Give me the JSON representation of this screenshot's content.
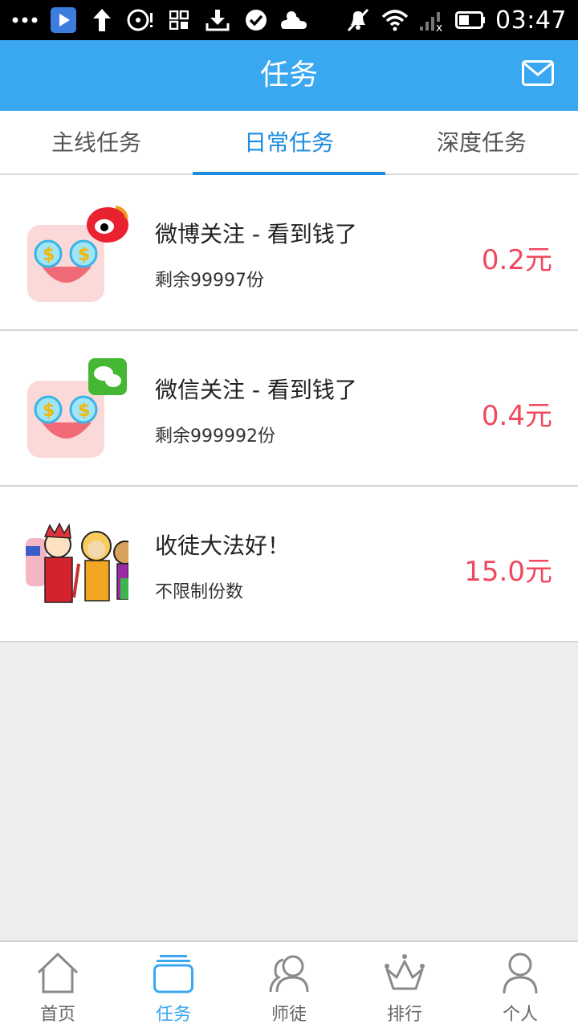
{
  "status_bar": {
    "icons": [
      "more-dots-icon",
      "play-app-icon",
      "upload-arrow-icon",
      "disc-icon",
      "grid-app-icon",
      "download-icon",
      "check-circle-icon",
      "cloud-icon",
      "mute-icon",
      "wifi-icon",
      "signal-icon",
      "battery-icon"
    ],
    "time": "03:47"
  },
  "app_bar": {
    "title": "任务",
    "mail_icon": "mail-icon",
    "color": "#3aa8f0"
  },
  "tabs": [
    {
      "label": "主线任务",
      "active": false
    },
    {
      "label": "日常任务",
      "active": true
    },
    {
      "label": "深度任务",
      "active": false
    }
  ],
  "tasks": [
    {
      "title": "微博关注 - 看到钱了",
      "sub": "剩余99997份",
      "price": "0.2元",
      "icon": "weibo-money-icon"
    },
    {
      "title": "微信关注 - 看到钱了",
      "sub": "剩余999992份",
      "price": "0.4元",
      "icon": "wechat-money-icon"
    },
    {
      "title": "收徒大法好！",
      "sub": "不限制份数",
      "price": "15.0元",
      "icon": "journey-west-characters-icon"
    }
  ],
  "bottom_nav": [
    {
      "label": "首页",
      "icon": "home-icon",
      "active": false
    },
    {
      "label": "任务",
      "icon": "tasks-icon",
      "active": true
    },
    {
      "label": "师徒",
      "icon": "people-icon",
      "active": false
    },
    {
      "label": "排行",
      "icon": "crown-icon",
      "active": false
    },
    {
      "label": "个人",
      "icon": "person-icon",
      "active": false
    }
  ],
  "colors": {
    "accent": "#1d8ce0",
    "price": "#f0485e",
    "background": "#ededed"
  }
}
